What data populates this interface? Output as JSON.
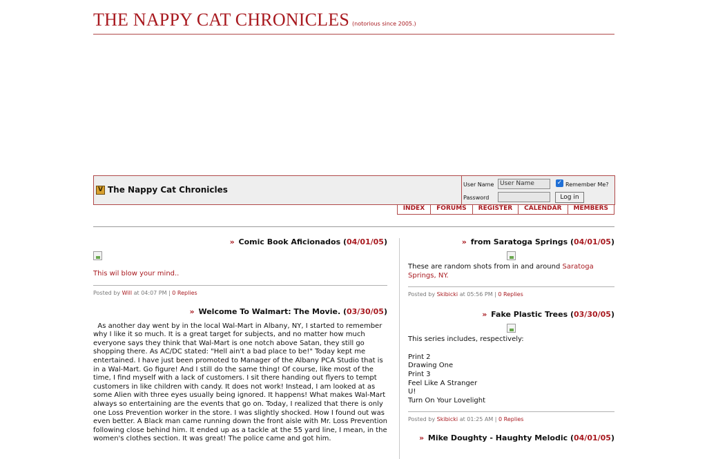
{
  "header": {
    "title": "THE NAPPY CAT CHRONICLES",
    "tagline": "(notorious since 2005.)"
  },
  "banner": {
    "logo_icon": "v-logo-icon",
    "logo_glyph": "V",
    "title": "The Nappy Cat Chronicles",
    "login": {
      "username_label": "User Name",
      "username_value": "User Name",
      "password_label": "Password",
      "password_value": "",
      "remember_label": "Remember Me?",
      "remember_checked": true,
      "login_button": "Log in"
    }
  },
  "nav": {
    "items": [
      "INDEX",
      "FORUMS",
      "REGISTER",
      "CALENDAR",
      "MEMBERS"
    ]
  },
  "colors": {
    "accent": "#a8191f",
    "border": "#b04848",
    "banner_bg": "#eeeeee"
  },
  "left_posts": [
    {
      "title": "Comic Book Aficionados",
      "date": "04/01/05",
      "has_image": true,
      "body_link": "This wil blow your mind..",
      "posted_by_label": "Posted by",
      "author": "Will",
      "at_label": "at",
      "time": "04:07 PM",
      "replies": "0 Replies"
    },
    {
      "title": "Welcome To Walmart: The Movie.",
      "date": "03/30/05",
      "body": "  As another day went by in the local Wal-Mart in Albany, NY, I started to remember why I like it so much. It is a great target for subjects, and no matter how much everyone says they think that Wal-Mart is one notch above Satan, they still go shopping there. As AC/DC stated: \"Hell ain't a bad place to be!\" Today kept me entertained. I have just been promoted to Manager of the Albany PCA Studio that is in a Wal-Mart. Go figure! And I still do the same thing! Of course, like most of the time, I find myself with a lack of customers. I sit there handing out flyers to tempt customers in like children with candy. It does not work! Instead, I am looked at as some Alien with three eyes usually being ignored. It happens! What makes Wal-Mart always so entertaining are the events that go on. Today, I realized that there is only one Loss Prevention worker in the store. I was slightly shocked. How I found out was even better. A Black man came running down the front aisle with Mr. Loss Prevention following close behind him. It ended up as a tackle at the 55 yard line, I mean, in the women's clothes section. It was great! The police came and got him."
    }
  ],
  "right_posts": [
    {
      "title": "from Saratoga Springs",
      "date": "04/01/05",
      "has_image": true,
      "body_text": "These are random shots from in and around ",
      "body_link": "Saratoga Springs, NY.",
      "posted_by_label": "Posted by",
      "author": "Skibicki",
      "at_label": "at",
      "time": "05:56 PM",
      "replies": "0 Replies"
    },
    {
      "title": "Fake Plastic Trees",
      "date": "03/30/05",
      "has_image": true,
      "intro": "This series includes, respectively:",
      "list": [
        "Print 2",
        "Drawing One",
        "Print 3",
        "Feel Like A Stranger",
        "U!",
        "Turn On Your Lovelight"
      ],
      "posted_by_label": "Posted by",
      "author": "Skibicki",
      "at_label": "at",
      "time": "01:25 AM",
      "replies": "0 Replies"
    },
    {
      "title": "Mike Doughty - Haughty Melodic",
      "date": "04/01/05"
    }
  ]
}
